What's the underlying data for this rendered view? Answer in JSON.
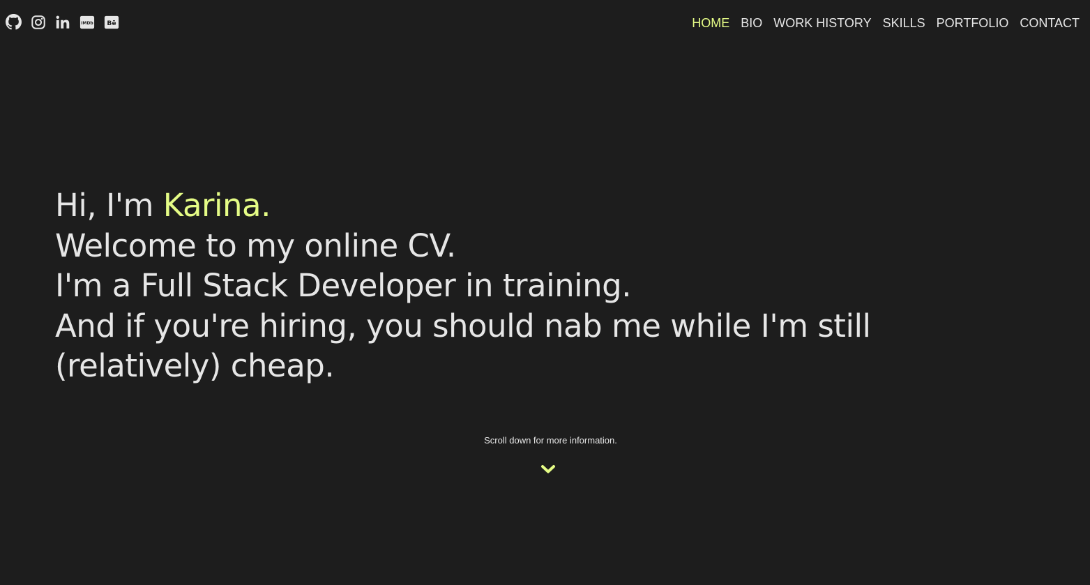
{
  "header": {
    "socials": [
      {
        "icon": "github-icon",
        "label": "GitHub"
      },
      {
        "icon": "instagram-icon",
        "label": "Instagram"
      },
      {
        "icon": "linkedin-icon",
        "label": "LinkedIn"
      },
      {
        "icon": "imdb-icon",
        "label": "IMDb"
      },
      {
        "icon": "behance-icon",
        "label": "Bē"
      }
    ],
    "nav": [
      {
        "label": "HOME",
        "active": true
      },
      {
        "label": "BIO"
      },
      {
        "label": "WORK HISTORY"
      },
      {
        "label": "SKILLS"
      },
      {
        "label": "PORTFOLIO"
      },
      {
        "label": "CONTACT"
      }
    ]
  },
  "hero": {
    "greeting_prefix": "Hi, I'm ",
    "name": "Karina.",
    "line2": "Welcome to my online CV.",
    "line3": "I'm a Full Stack Developer in training.",
    "line4": "And if you're hiring, you should nab me while I'm still (relatively) cheap."
  },
  "scroll": {
    "hint": "Scroll down for more information."
  },
  "colors": {
    "background": "#1d1d1d",
    "text": "#e6e6e6",
    "accent": "#e5fc86"
  }
}
